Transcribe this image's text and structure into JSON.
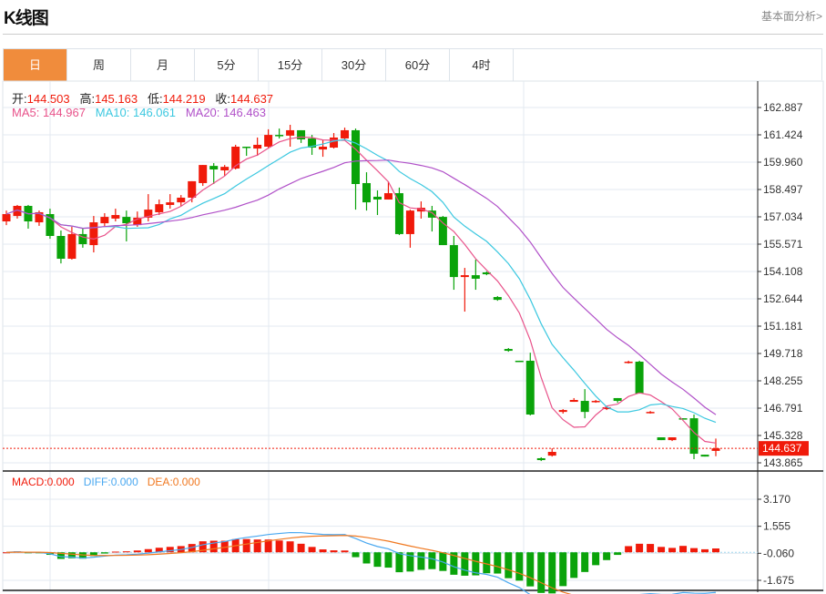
{
  "header": {
    "title": "K线图",
    "link": "基本面分析>"
  },
  "tabs": [
    {
      "label": "日",
      "active": true
    },
    {
      "label": "周"
    },
    {
      "label": "月"
    },
    {
      "label": "5分"
    },
    {
      "label": "15分"
    },
    {
      "label": "30分"
    },
    {
      "label": "60分"
    },
    {
      "label": "4时"
    }
  ],
  "ohlc_info": {
    "open_label": "开:",
    "open": "144.503",
    "high_label": "高:",
    "high": "145.163",
    "low_label": "低:",
    "low": "144.219",
    "close_label": "收:",
    "close": "144.637"
  },
  "ma_info": {
    "ma5": "MA5: 144.967",
    "ma10": "MA10: 146.061",
    "ma20": "MA20: 146.463"
  },
  "macd_info": {
    "macd": "MACD:0.000",
    "diff": "DIFF:0.000",
    "dea": "DEA:0.000"
  },
  "colors": {
    "up": "#f01a0a",
    "down": "#0aa30a",
    "ma5": "#e8528a",
    "ma10": "#3cc8e0",
    "ma20": "#b050c8",
    "diff": "#4aa8f0",
    "dea": "#f07820",
    "accent": "#f08c3c"
  },
  "chart_data": {
    "type": "candlestick",
    "price_ticks": [
      "162.887",
      "161.424",
      "159.960",
      "158.497",
      "157.034",
      "155.571",
      "154.108",
      "152.644",
      "151.181",
      "149.718",
      "148.255",
      "146.791",
      "145.328",
      "143.865"
    ],
    "price_range": [
      143.865,
      162.887
    ],
    "last_price": "144.637",
    "macd_ticks": [
      "3.170",
      "1.555",
      "-0.060",
      "-1.675"
    ],
    "macd_range": [
      -1.675,
      3.17
    ],
    "candles": [
      [
        156.79,
        157.37,
        156.59,
        157.18
      ],
      [
        157.08,
        157.67,
        156.94,
        157.62
      ],
      [
        157.62,
        157.67,
        156.4,
        156.79
      ],
      [
        156.74,
        157.37,
        156.55,
        157.28
      ],
      [
        157.18,
        157.47,
        155.86,
        156.01
      ],
      [
        156.01,
        156.3,
        154.54,
        154.79
      ],
      [
        154.79,
        156.5,
        154.74,
        156.11
      ],
      [
        156.11,
        156.45,
        155.38,
        155.57
      ],
      [
        155.52,
        157.08,
        155.13,
        156.74
      ],
      [
        156.69,
        157.23,
        156.5,
        157.03
      ],
      [
        156.94,
        157.47,
        156.79,
        157.13
      ],
      [
        157.03,
        157.37,
        155.72,
        156.69
      ],
      [
        156.59,
        157.32,
        156.5,
        156.99
      ],
      [
        156.99,
        158.25,
        156.79,
        157.42
      ],
      [
        157.28,
        157.96,
        157.13,
        157.71
      ],
      [
        157.67,
        158.25,
        157.47,
        157.81
      ],
      [
        157.81,
        158.2,
        157.62,
        158.06
      ],
      [
        158.06,
        158.94,
        157.81,
        158.94
      ],
      [
        158.84,
        159.81,
        158.69,
        159.81
      ],
      [
        159.76,
        159.91,
        158.79,
        159.57
      ],
      [
        159.52,
        159.81,
        159.23,
        159.71
      ],
      [
        159.62,
        160.89,
        159.57,
        160.79
      ],
      [
        160.79,
        160.79,
        160.3,
        160.74
      ],
      [
        160.69,
        161.28,
        160.3,
        160.89
      ],
      [
        160.79,
        161.72,
        160.69,
        161.42
      ],
      [
        161.42,
        161.76,
        161.23,
        161.38
      ],
      [
        161.38,
        161.96,
        160.79,
        161.67
      ],
      [
        161.67,
        161.67,
        160.99,
        161.18
      ],
      [
        161.23,
        161.42,
        160.35,
        160.74
      ],
      [
        160.64,
        161.13,
        160.25,
        160.79
      ],
      [
        160.74,
        161.52,
        160.69,
        161.28
      ],
      [
        161.23,
        161.81,
        161.18,
        161.67
      ],
      [
        161.67,
        161.76,
        157.42,
        158.79
      ],
      [
        158.84,
        159.42,
        157.37,
        157.81
      ],
      [
        158.11,
        158.45,
        157.13,
        157.96
      ],
      [
        157.96,
        158.94,
        157.96,
        158.3
      ],
      [
        158.3,
        158.6,
        156.06,
        156.11
      ],
      [
        156.11,
        157.42,
        155.38,
        157.37
      ],
      [
        157.32,
        157.86,
        156.94,
        157.52
      ],
      [
        157.37,
        157.62,
        156.25,
        156.99
      ],
      [
        157.03,
        157.08,
        155.52,
        155.52
      ],
      [
        155.52,
        156.01,
        153.13,
        153.81
      ],
      [
        153.81,
        154.3,
        151.96,
        153.91
      ],
      [
        153.91,
        154.74,
        153.13,
        153.72
      ],
      [
        154.06,
        154.11,
        153.91,
        153.96
      ],
      [
        152.74,
        152.79,
        152.54,
        152.59
      ],
      [
        149.96,
        150.01,
        149.81,
        149.86
      ],
      [
        149.33,
        149.33,
        149.28,
        149.28
      ],
      [
        149.33,
        149.76,
        146.4,
        146.45
      ],
      [
        144.11,
        144.16,
        143.96,
        144.01
      ],
      [
        144.25,
        144.64,
        144.2,
        144.45
      ],
      [
        146.59,
        146.74,
        146.5,
        146.69
      ],
      [
        147.13,
        147.33,
        147.13,
        147.23
      ],
      [
        147.18,
        147.81,
        146.25,
        146.59
      ],
      [
        147.13,
        147.23,
        147.08,
        147.18
      ],
      [
        146.74,
        146.89,
        146.69,
        146.84
      ],
      [
        147.33,
        147.33,
        147.08,
        147.18
      ],
      [
        149.23,
        149.33,
        149.18,
        149.28
      ],
      [
        149.28,
        149.33,
        147.57,
        147.57
      ],
      [
        146.54,
        146.64,
        146.5,
        146.59
      ],
      [
        145.23,
        145.23,
        145.08,
        145.08
      ],
      [
        145.08,
        145.23,
        145.03,
        145.23
      ],
      [
        146.25,
        146.25,
        146.2,
        146.2
      ],
      [
        146.25,
        146.45,
        144.06,
        144.35
      ],
      [
        144.3,
        144.3,
        144.2,
        144.2
      ],
      [
        144.503,
        145.163,
        144.219,
        144.637
      ]
    ]
  }
}
